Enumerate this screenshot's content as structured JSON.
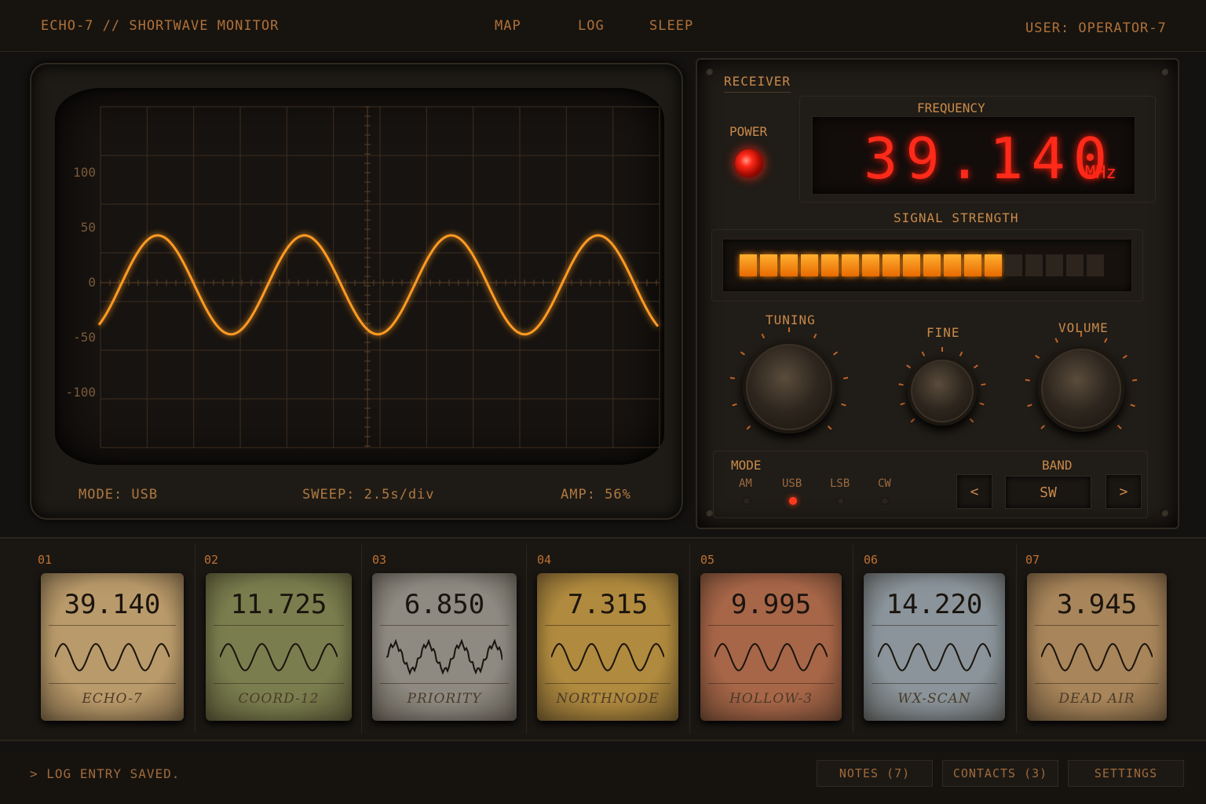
{
  "header": {
    "title": "ECHO-7 //  SHORTWAVE MONITOR",
    "nav": [
      "MAP",
      "LOG",
      "SLEEP"
    ],
    "user": "USER: OPERATOR-7"
  },
  "scope": {
    "y_ticks": [
      "100",
      "50",
      "0",
      "-50",
      "-100"
    ],
    "mode_text": "MODE: USB",
    "sweep_text": "SWEEP: 2.5s/div",
    "amp_text": "AMP: 56%"
  },
  "receiver": {
    "title": "RECEIVER",
    "power_label": "POWER",
    "frequency_label": "FREQUENCY",
    "frequency_value": "39.140",
    "frequency_unit": "MHz",
    "signal_label": "SIGNAL STRENGTH",
    "signal_level": 0.72,
    "knobs": {
      "tuning": "TUNING",
      "fine": "FINE",
      "volume": "VOLUME"
    },
    "mode_label": "MODE",
    "modes": [
      "AM",
      "USB",
      "LSB",
      "CW"
    ],
    "active_mode": "USB",
    "band_label": "BAND",
    "band_prev": "<",
    "band_value": "SW",
    "band_next": ">"
  },
  "presets": [
    {
      "slot": "01",
      "freq": "39.140",
      "name": "ECHO-7",
      "color": "#b99a6a"
    },
    {
      "slot": "02",
      "freq": "11.725",
      "name": "COORD-12",
      "color": "#7a7e4e"
    },
    {
      "slot": "03",
      "freq": "6.850",
      "name": "PRIORITY",
      "color": "#8e8a82"
    },
    {
      "slot": "04",
      "freq": "7.315",
      "name": "NORTHNODE",
      "color": "#b08a3e"
    },
    {
      "slot": "05",
      "freq": "9.995",
      "name": "HOLLOW-3",
      "color": "#a86648"
    },
    {
      "slot": "06",
      "freq": "14.220",
      "name": "WX-SCAN",
      "color": "#8a949a"
    },
    {
      "slot": "07",
      "freq": "3.945",
      "name": "DEAD AIR",
      "color": "#a8855a"
    }
  ],
  "footer": {
    "log_status": "> LOG ENTRY SAVED.",
    "notes": "NOTES (7)",
    "contacts": "CONTACTS (3)",
    "settings": "SETTINGS"
  }
}
